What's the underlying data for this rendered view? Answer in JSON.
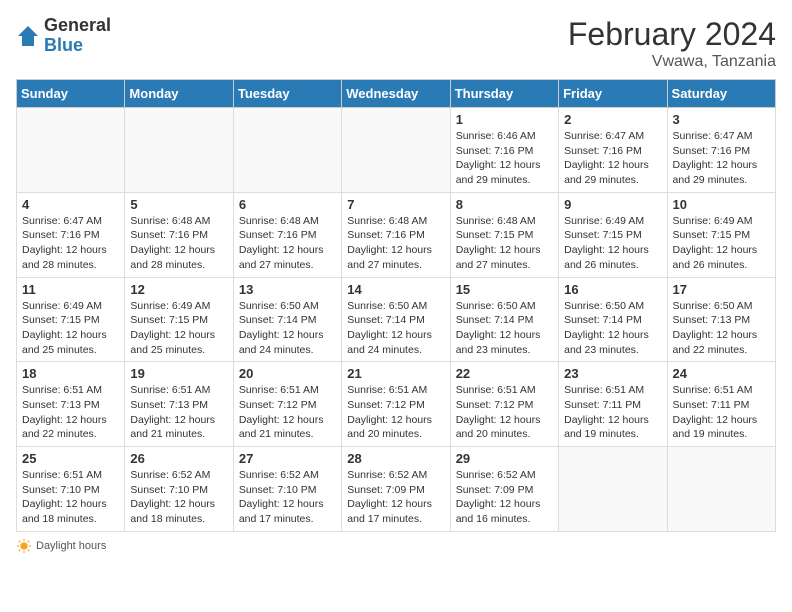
{
  "logo": {
    "text_general": "General",
    "text_blue": "Blue"
  },
  "title": "February 2024",
  "subtitle": "Vwawa, Tanzania",
  "days_of_week": [
    "Sunday",
    "Monday",
    "Tuesday",
    "Wednesday",
    "Thursday",
    "Friday",
    "Saturday"
  ],
  "footer_label": "Daylight hours",
  "weeks": [
    [
      {
        "day": "",
        "info": ""
      },
      {
        "day": "",
        "info": ""
      },
      {
        "day": "",
        "info": ""
      },
      {
        "day": "",
        "info": ""
      },
      {
        "day": "1",
        "info": "Sunrise: 6:46 AM\nSunset: 7:16 PM\nDaylight: 12 hours and 29 minutes."
      },
      {
        "day": "2",
        "info": "Sunrise: 6:47 AM\nSunset: 7:16 PM\nDaylight: 12 hours and 29 minutes."
      },
      {
        "day": "3",
        "info": "Sunrise: 6:47 AM\nSunset: 7:16 PM\nDaylight: 12 hours and 29 minutes."
      }
    ],
    [
      {
        "day": "4",
        "info": "Sunrise: 6:47 AM\nSunset: 7:16 PM\nDaylight: 12 hours and 28 minutes."
      },
      {
        "day": "5",
        "info": "Sunrise: 6:48 AM\nSunset: 7:16 PM\nDaylight: 12 hours and 28 minutes."
      },
      {
        "day": "6",
        "info": "Sunrise: 6:48 AM\nSunset: 7:16 PM\nDaylight: 12 hours and 27 minutes."
      },
      {
        "day": "7",
        "info": "Sunrise: 6:48 AM\nSunset: 7:16 PM\nDaylight: 12 hours and 27 minutes."
      },
      {
        "day": "8",
        "info": "Sunrise: 6:48 AM\nSunset: 7:15 PM\nDaylight: 12 hours and 27 minutes."
      },
      {
        "day": "9",
        "info": "Sunrise: 6:49 AM\nSunset: 7:15 PM\nDaylight: 12 hours and 26 minutes."
      },
      {
        "day": "10",
        "info": "Sunrise: 6:49 AM\nSunset: 7:15 PM\nDaylight: 12 hours and 26 minutes."
      }
    ],
    [
      {
        "day": "11",
        "info": "Sunrise: 6:49 AM\nSunset: 7:15 PM\nDaylight: 12 hours and 25 minutes."
      },
      {
        "day": "12",
        "info": "Sunrise: 6:49 AM\nSunset: 7:15 PM\nDaylight: 12 hours and 25 minutes."
      },
      {
        "day": "13",
        "info": "Sunrise: 6:50 AM\nSunset: 7:14 PM\nDaylight: 12 hours and 24 minutes."
      },
      {
        "day": "14",
        "info": "Sunrise: 6:50 AM\nSunset: 7:14 PM\nDaylight: 12 hours and 24 minutes."
      },
      {
        "day": "15",
        "info": "Sunrise: 6:50 AM\nSunset: 7:14 PM\nDaylight: 12 hours and 23 minutes."
      },
      {
        "day": "16",
        "info": "Sunrise: 6:50 AM\nSunset: 7:14 PM\nDaylight: 12 hours and 23 minutes."
      },
      {
        "day": "17",
        "info": "Sunrise: 6:50 AM\nSunset: 7:13 PM\nDaylight: 12 hours and 22 minutes."
      }
    ],
    [
      {
        "day": "18",
        "info": "Sunrise: 6:51 AM\nSunset: 7:13 PM\nDaylight: 12 hours and 22 minutes."
      },
      {
        "day": "19",
        "info": "Sunrise: 6:51 AM\nSunset: 7:13 PM\nDaylight: 12 hours and 21 minutes."
      },
      {
        "day": "20",
        "info": "Sunrise: 6:51 AM\nSunset: 7:12 PM\nDaylight: 12 hours and 21 minutes."
      },
      {
        "day": "21",
        "info": "Sunrise: 6:51 AM\nSunset: 7:12 PM\nDaylight: 12 hours and 20 minutes."
      },
      {
        "day": "22",
        "info": "Sunrise: 6:51 AM\nSunset: 7:12 PM\nDaylight: 12 hours and 20 minutes."
      },
      {
        "day": "23",
        "info": "Sunrise: 6:51 AM\nSunset: 7:11 PM\nDaylight: 12 hours and 19 minutes."
      },
      {
        "day": "24",
        "info": "Sunrise: 6:51 AM\nSunset: 7:11 PM\nDaylight: 12 hours and 19 minutes."
      }
    ],
    [
      {
        "day": "25",
        "info": "Sunrise: 6:51 AM\nSunset: 7:10 PM\nDaylight: 12 hours and 18 minutes."
      },
      {
        "day": "26",
        "info": "Sunrise: 6:52 AM\nSunset: 7:10 PM\nDaylight: 12 hours and 18 minutes."
      },
      {
        "day": "27",
        "info": "Sunrise: 6:52 AM\nSunset: 7:10 PM\nDaylight: 12 hours and 17 minutes."
      },
      {
        "day": "28",
        "info": "Sunrise: 6:52 AM\nSunset: 7:09 PM\nDaylight: 12 hours and 17 minutes."
      },
      {
        "day": "29",
        "info": "Sunrise: 6:52 AM\nSunset: 7:09 PM\nDaylight: 12 hours and 16 minutes."
      },
      {
        "day": "",
        "info": ""
      },
      {
        "day": "",
        "info": ""
      }
    ]
  ]
}
